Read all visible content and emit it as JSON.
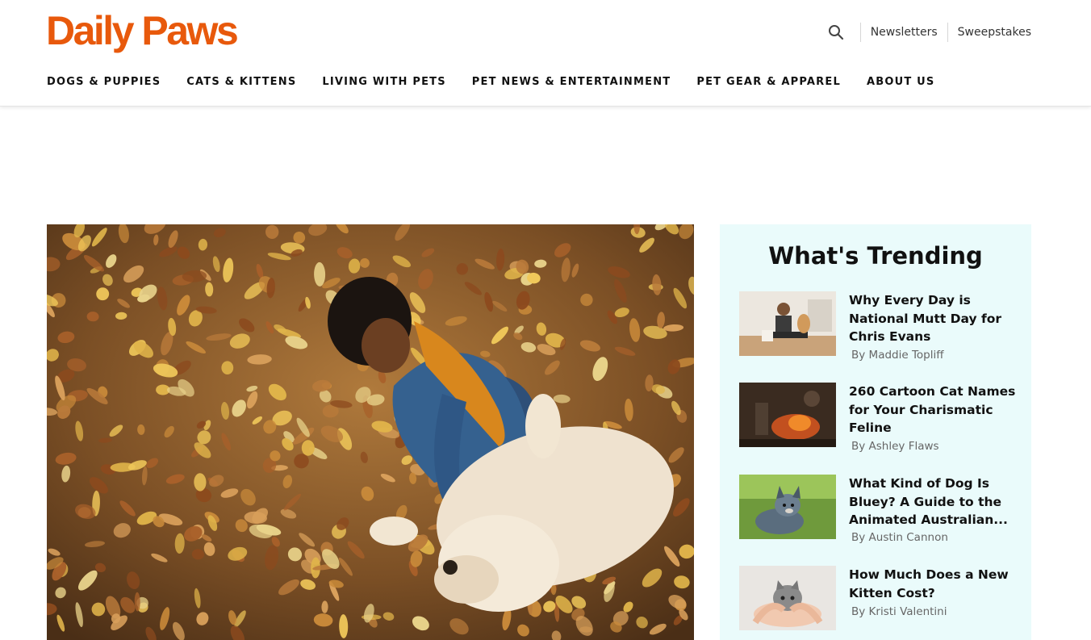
{
  "site": {
    "logo_text": "Daily Paws",
    "brand_color": "#e8590c"
  },
  "utility": {
    "search_icon": "magnifier-icon",
    "newsletters": "Newsletters",
    "sweepstakes": "Sweepstakes"
  },
  "nav": [
    {
      "label": "DOGS & PUPPIES"
    },
    {
      "label": "CATS & KITTENS"
    },
    {
      "label": "LIVING WITH PETS"
    },
    {
      "label": "PET NEWS & ENTERTAINMENT"
    },
    {
      "label": "PET GEAR & APPAREL"
    },
    {
      "label": "ABOUT US"
    }
  ],
  "trending": {
    "title": "What's Trending",
    "background": "#eafbfb",
    "items": [
      {
        "title": "Why Every Day is National Mutt Day for Chris Evans",
        "byline": "By Maddie Topliff"
      },
      {
        "title": "260 Cartoon Cat Names for Your Charismatic Feline",
        "byline": "By Ashley Flaws"
      },
      {
        "title": "What Kind of Dog Is Bluey? A Guide to the Animated Australian...",
        "byline": "By Austin Cannon"
      },
      {
        "title": "How Much Does a New Kitten Cost?",
        "byline": "By Kristi Valentini"
      }
    ]
  }
}
